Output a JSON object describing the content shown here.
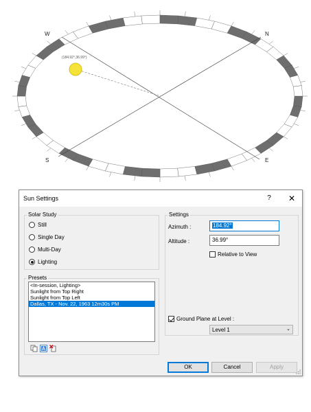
{
  "sun_path": {
    "compass": {
      "west": "W",
      "north": "N",
      "south": "S",
      "east": "E"
    },
    "sun_label": "(184.92°,36.99°)"
  },
  "dialog": {
    "title": "Sun Settings",
    "help_label": "?",
    "close_label": "✕",
    "solar_study": {
      "label": "Solar Study",
      "options": [
        "Still",
        "Single Day",
        "Multi-Day",
        "Lighting"
      ],
      "selected": "Lighting"
    },
    "presets": {
      "label": "Presets",
      "items": [
        "<In-session, Lighting>",
        "Sunlight from Top Right",
        "Sunlight from Top Left",
        "Dallas, TX - Nov. 22, 1963 12m30s PM"
      ],
      "selected_index": 3
    },
    "settings": {
      "label": "Settings",
      "azimuth_label": "Azimuth :",
      "azimuth_value": "184.92°",
      "altitude_label": "Altitude :",
      "altitude_value": "36.99°",
      "relative_to_view_label": "Relative to View",
      "relative_to_view_checked": false,
      "ground_plane_label": "Ground Plane at Level :",
      "ground_plane_checked": true,
      "level_value": "Level 1"
    },
    "buttons": {
      "ok": "OK",
      "cancel": "Cancel",
      "apply": "Apply"
    }
  },
  "colors": {
    "accent": "#0078d7",
    "sun": "#f5e33a",
    "ring_dark": "#6e6e6e"
  }
}
